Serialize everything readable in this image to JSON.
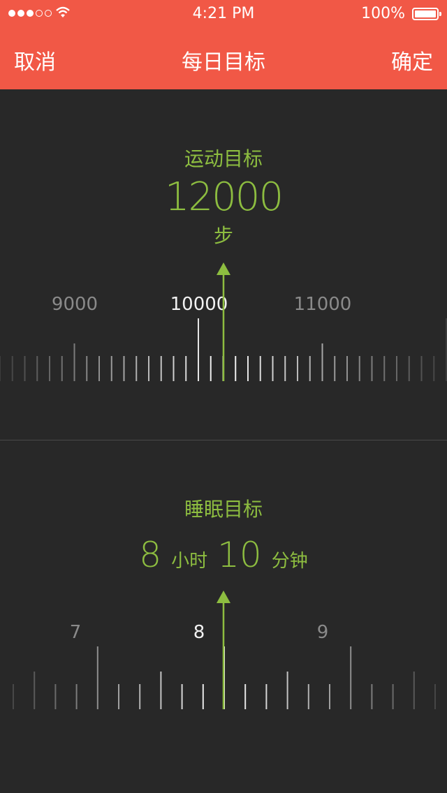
{
  "status_bar": {
    "time": "4:21 PM",
    "battery": "100%"
  },
  "nav": {
    "cancel": "取消",
    "title": "每日目标",
    "confirm": "确定"
  },
  "steps_goal": {
    "title": "运动目标",
    "value": "12000",
    "unit": "步",
    "ruler_labels": [
      "9000",
      "10000",
      "11000"
    ]
  },
  "sleep_goal": {
    "title": "睡眠目标",
    "hours": "8",
    "hours_unit": "小时",
    "minutes": "10",
    "minutes_unit": "分钟",
    "ruler_labels": [
      "7",
      "8",
      "9"
    ]
  },
  "colors": {
    "header": "#f15846",
    "accent": "#8dbd40",
    "background": "#282828"
  }
}
